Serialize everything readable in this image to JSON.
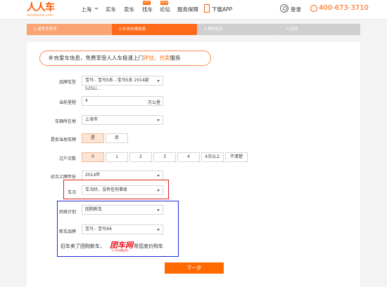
{
  "header": {
    "logo_cn": "人人车",
    "logo_en": "renrenche.com",
    "city": "上海",
    "nav": [
      {
        "label": "买车",
        "tag": ""
      },
      {
        "label": "卖车",
        "tag": ""
      },
      {
        "label": "找车",
        "tag": "HOT"
      },
      {
        "label": "论坛",
        "tag": "NEW"
      },
      {
        "label": "服务保障",
        "tag": ""
      }
    ],
    "app_label": "下载APP",
    "login_label": "登录",
    "phone": "400-673-3710",
    "brand_color": "#ff5a00"
  },
  "steps": [
    {
      "label": "1.填写手机号",
      "state": "done"
    },
    {
      "label": "2.补充车辆信息",
      "state": "current"
    },
    {
      "label": "3.预约验车",
      "state": "todo"
    },
    {
      "label": "4.完成",
      "state": "todo"
    }
  ],
  "notice": {
    "prefix": "补充爱车信息，免费享受人人车极速上门",
    "highlight": "评估、代卖",
    "suffix": "服务"
  },
  "form": {
    "brand_label": "品牌车型",
    "brand_value": "宝马 - 宝马5系 - 宝马5系 2014款 525Li...",
    "mileage_label": "当前里程",
    "mileage_value": "4",
    "mileage_unit": "万公里",
    "location_label": "车辆所在地",
    "location_value": "上海市",
    "local_plate_label": "是否当地车牌",
    "local_plate_options": [
      "是",
      "否"
    ],
    "local_plate_selected": "是",
    "transfer_label": "过户次数",
    "transfer_options": [
      "0",
      "1",
      "2",
      "3",
      "4",
      "4次以上",
      "不清楚"
    ],
    "transfer_selected": "0",
    "first_reg_label": "初次上牌年份",
    "first_reg_value": "2014年",
    "condition_label": "车况",
    "condition_value": "车况好，没有任何事故",
    "plan_label": "后续计划",
    "plan_value": "团购新车",
    "new_brand_label": "新车品牌",
    "new_brand_value": "宝马 - 宝马X6"
  },
  "promo": {
    "text_before": "旧车卖了团购新车，",
    "logo_text": "团车网",
    "logo_sub": "人人车战略合作",
    "text_after": "帮您底价购车"
  },
  "next_button": "下一步"
}
